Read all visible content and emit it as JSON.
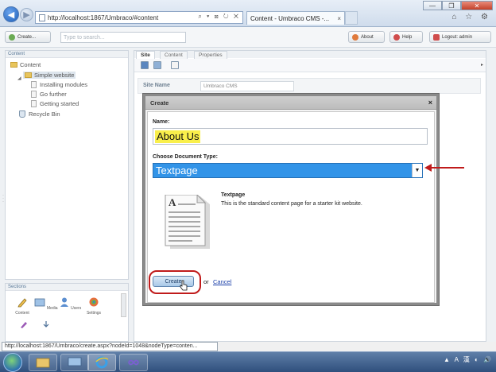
{
  "browser": {
    "address": "http://localhost:1867/Umbraco/#content",
    "tab_title": "Content - Umbraco CMS -...",
    "tab_close": "×",
    "controls": {
      "minimize": "—",
      "maximize": "❐",
      "close": "✕"
    },
    "tool_icons": "⌂ ☆ ⚙",
    "status_url": "http://localhost:1867/Umbraco/create.aspx?nodeId=1048&nodeType=conten..."
  },
  "topbar": {
    "create_label": "Create...",
    "search_placeholder": "Type to search...",
    "about_label": "About",
    "help_label": "Help",
    "logout_label": "Logout: admin"
  },
  "content_panel": {
    "header": "Content",
    "tree": {
      "root": "Content",
      "site": "Simple website",
      "children": [
        "Installing modules",
        "Go further",
        "Getting started"
      ],
      "recycle_bin": "Recycle Bin"
    }
  },
  "sections_panel": {
    "header": "Sections",
    "items": [
      "Content",
      "Media",
      "Users",
      "Settings"
    ]
  },
  "editor": {
    "tabs": [
      "Site",
      "Content",
      "Properties"
    ],
    "site_name_label": "Site Name",
    "site_name_value": "Umbraco CMS"
  },
  "modal": {
    "title": "Create",
    "close": "×",
    "name_label": "Name:",
    "name_value": "About Us",
    "doctype_label": "Choose Document Type:",
    "doctype_value": "Textpage",
    "doctype_title": "Textpage",
    "doctype_description": "This is the standard content page for a starter kit website.",
    "create_button": "Create",
    "or_text": "or",
    "cancel_link": "Cancel"
  },
  "taskbar": {
    "tray_text": "▲ A 漢 ◐ 🔊"
  },
  "colors": {
    "select_highlight": "#3294e8",
    "name_highlight": "#f9ef4b",
    "annotation_red": "#c01b1b"
  }
}
